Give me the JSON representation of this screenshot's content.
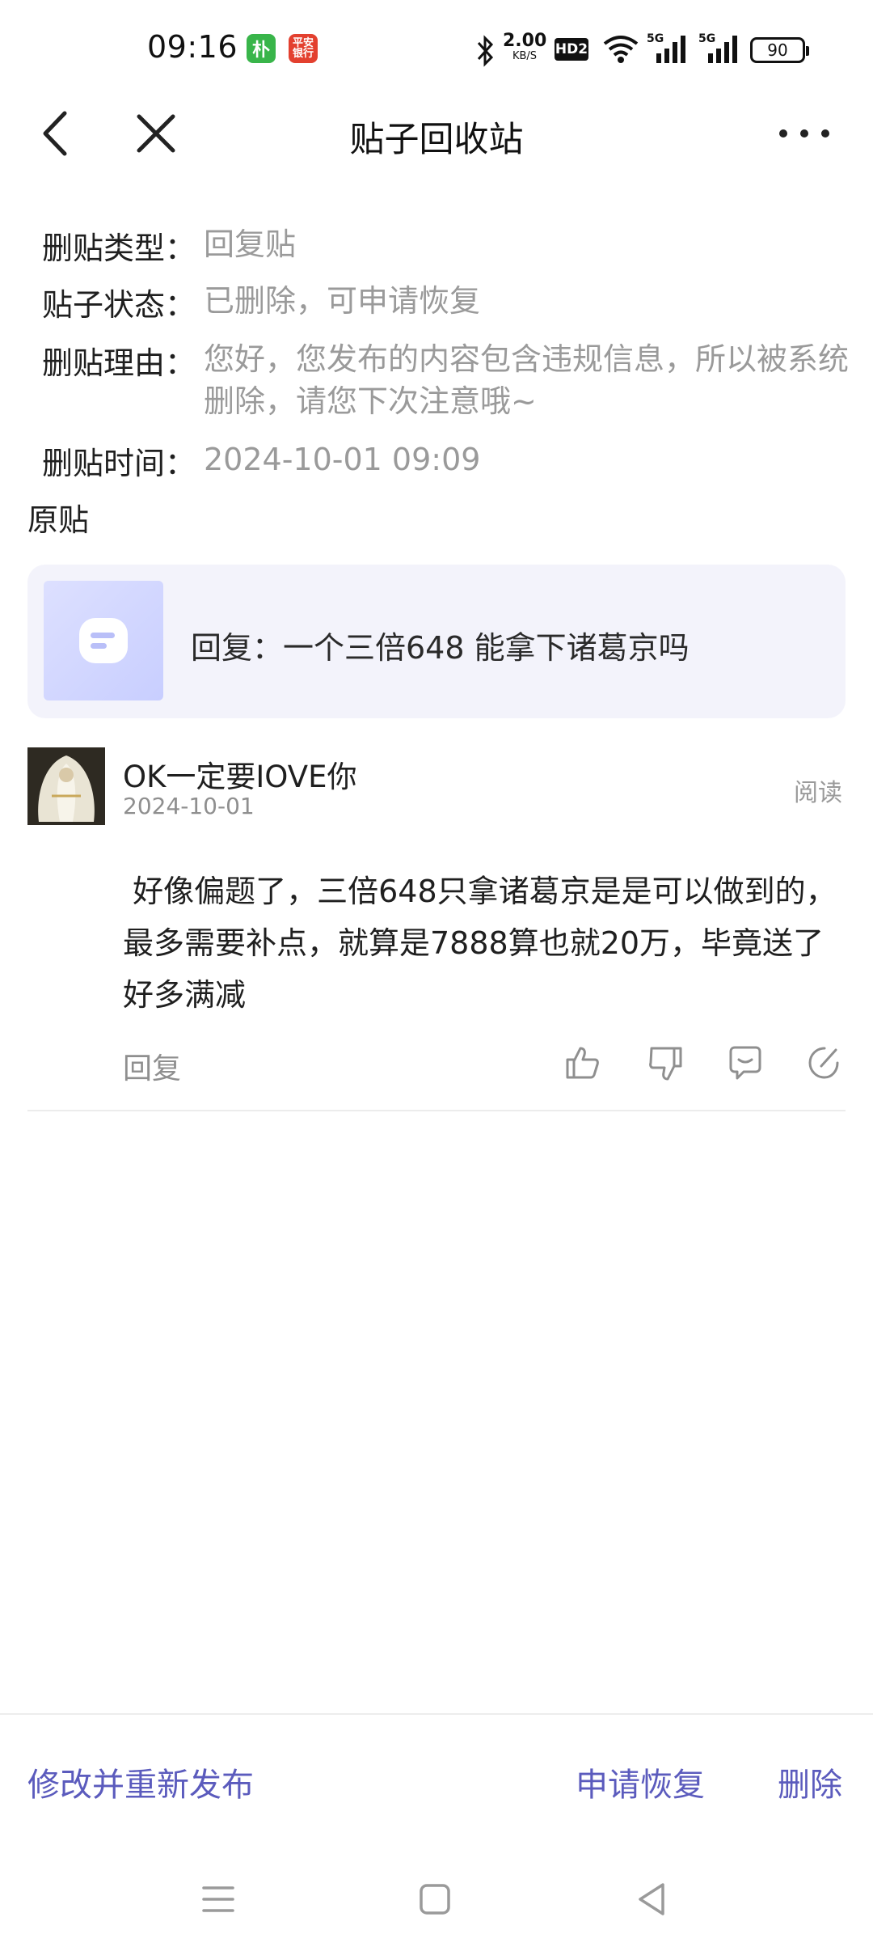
{
  "status_bar": {
    "time": "09:16",
    "app_icons": [
      {
        "name": "朴",
        "color": "#39b54a"
      },
      {
        "name": "平安银行",
        "color": "#e3402f"
      }
    ],
    "net_speed": "2.00",
    "net_unit": "KB/S",
    "hd": "HD2",
    "signal1": "5G",
    "signal2": "5G",
    "battery": "90"
  },
  "header": {
    "title": "贴子回收站"
  },
  "info": {
    "type_label": "删贴类型：",
    "type_value": "回复贴",
    "status_label": "贴子状态：",
    "status_value": "已删除，可申请恢复",
    "reason_label": "删贴理由：",
    "reason_value": "您好，您发布的内容包含违规信息，所以被系统删除，请您下次注意哦~",
    "time_label": "删贴时间：",
    "time_value": "2024-10-01 09:09"
  },
  "original": {
    "section_title": "原贴",
    "card_text": "回复：一个三倍648 能拿下诸葛京吗"
  },
  "reply": {
    "username": "OK一定要IOVE你",
    "date": "2024-10-01",
    "read_label": "阅读",
    "body": " 好像偏题了，三倍648只拿诸葛京是是可以做到的，最多需要补点，就算是7888算也就20万，毕竟送了好多满减",
    "reply_label": "回复"
  },
  "bottom_actions": {
    "edit_repost": "修改并重新发布",
    "request_restore": "申请恢复",
    "delete": "删除"
  },
  "colors": {
    "accent": "#5b5bbd",
    "muted": "#9a9a9a",
    "card_bg": "#f3f3fb"
  }
}
